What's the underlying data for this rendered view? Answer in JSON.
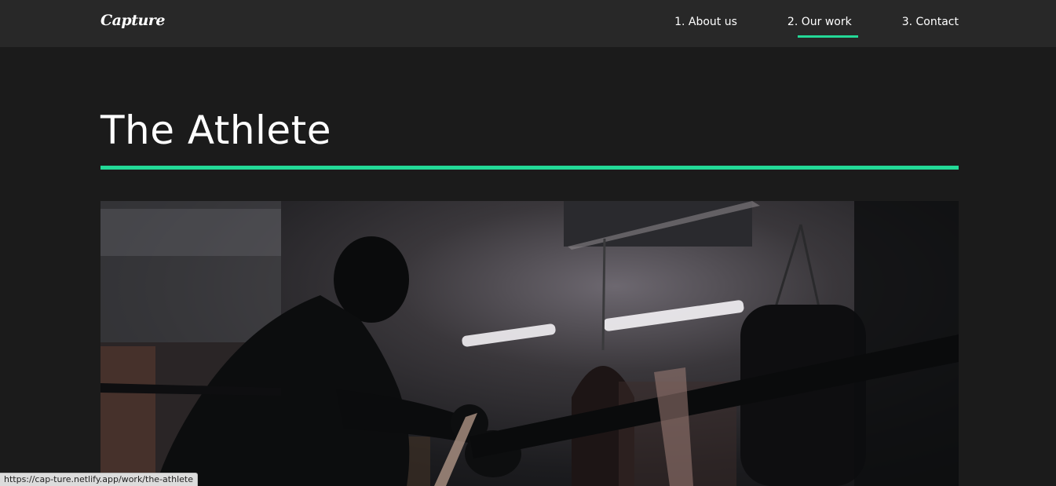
{
  "nav": {
    "logo": "Capture",
    "links": [
      {
        "label": "1. About us"
      },
      {
        "label": "2. Our work",
        "active": true
      },
      {
        "label": "3. Contact"
      }
    ]
  },
  "page": {
    "title": "The Athlete",
    "hero_image_alt": "boxer leaning on ring ropes in a dim gym"
  },
  "status_bar": {
    "url": "https://cap-ture.netlify.app/work/the-athlete"
  },
  "colors": {
    "accent": "#23d997",
    "background": "#1b1b1b",
    "nav_background": "#282828"
  }
}
